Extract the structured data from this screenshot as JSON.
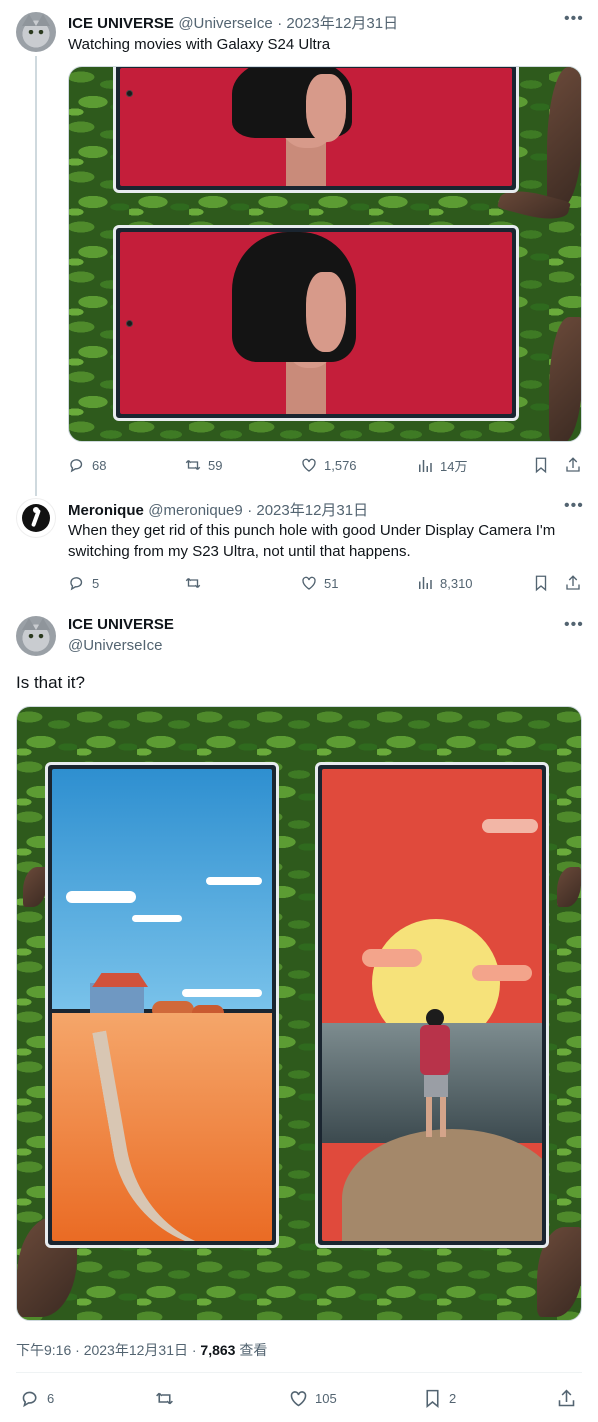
{
  "tweet1": {
    "name": "ICE UNIVERSE",
    "handle": "@UniverseIce",
    "date": "· 2023年12月31日",
    "text": "Watching movies with Galaxy S24 Ultra",
    "actions": {
      "replies": "68",
      "retweets": "59",
      "likes": "1,576",
      "views": "14万"
    }
  },
  "tweet2": {
    "name": "Meronique",
    "handle": "@meronique9",
    "date": "· 2023年12月31日",
    "text": "When they get rid of this punch hole with good Under Display Camera I'm switching from my S23 Ultra, not until that happens.",
    "actions": {
      "replies": "5",
      "retweets": "",
      "likes": "51",
      "views": "8,310"
    }
  },
  "tweet3": {
    "name": "ICE UNIVERSE",
    "handle": "@UniverseIce",
    "text": "Is that it?",
    "meta": {
      "time": "下午9:16 · 2023年12月31日 · ",
      "views": "7,863",
      "views_label": " 查看"
    },
    "actions": {
      "replies": "6",
      "retweets": "",
      "likes": "105",
      "bookmarks": "2"
    }
  },
  "icons": [
    "more-icon",
    "reply-icon",
    "retweet-icon",
    "like-icon",
    "views-icon",
    "bookmark-icon",
    "share-icon"
  ],
  "colors": {
    "text": "#0f1419",
    "secondary": "#536471",
    "border": "#cfd9de"
  }
}
